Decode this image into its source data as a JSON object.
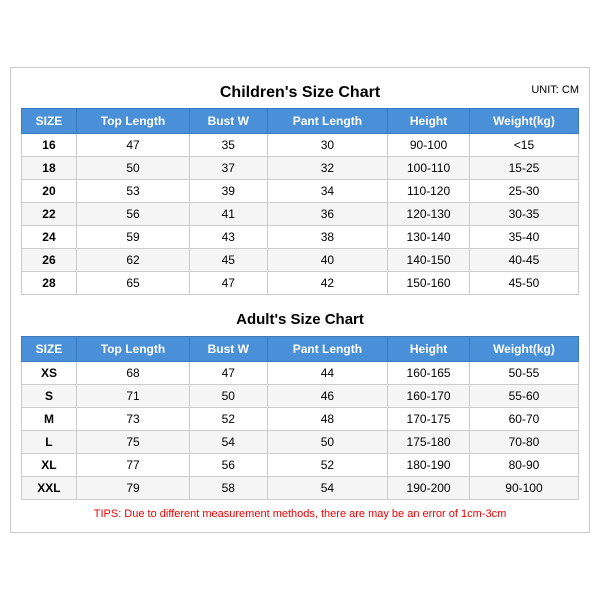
{
  "title": "Children's Size Chart",
  "unit": "UNIT: CM",
  "children_headers": [
    "SIZE",
    "Top Length",
    "Bust W",
    "Pant Length",
    "Height",
    "Weight(kg)"
  ],
  "children_rows": [
    [
      "16",
      "47",
      "35",
      "30",
      "90-100",
      "<15"
    ],
    [
      "18",
      "50",
      "37",
      "32",
      "100-110",
      "15-25"
    ],
    [
      "20",
      "53",
      "39",
      "34",
      "110-120",
      "25-30"
    ],
    [
      "22",
      "56",
      "41",
      "36",
      "120-130",
      "30-35"
    ],
    [
      "24",
      "59",
      "43",
      "38",
      "130-140",
      "35-40"
    ],
    [
      "26",
      "62",
      "45",
      "40",
      "140-150",
      "40-45"
    ],
    [
      "28",
      "65",
      "47",
      "42",
      "150-160",
      "45-50"
    ]
  ],
  "adults_title": "Adult's Size Chart",
  "adults_headers": [
    "SIZE",
    "Top Length",
    "Bust W",
    "Pant Length",
    "Height",
    "Weight(kg)"
  ],
  "adults_rows": [
    [
      "XS",
      "68",
      "47",
      "44",
      "160-165",
      "50-55"
    ],
    [
      "S",
      "71",
      "50",
      "46",
      "160-170",
      "55-60"
    ],
    [
      "M",
      "73",
      "52",
      "48",
      "170-175",
      "60-70"
    ],
    [
      "L",
      "75",
      "54",
      "50",
      "175-180",
      "70-80"
    ],
    [
      "XL",
      "77",
      "56",
      "52",
      "180-190",
      "80-90"
    ],
    [
      "XXL",
      "79",
      "58",
      "54",
      "190-200",
      "90-100"
    ]
  ],
  "tips": "TIPS: Due to different measurement methods, there are may be an error of 1cm-3cm"
}
